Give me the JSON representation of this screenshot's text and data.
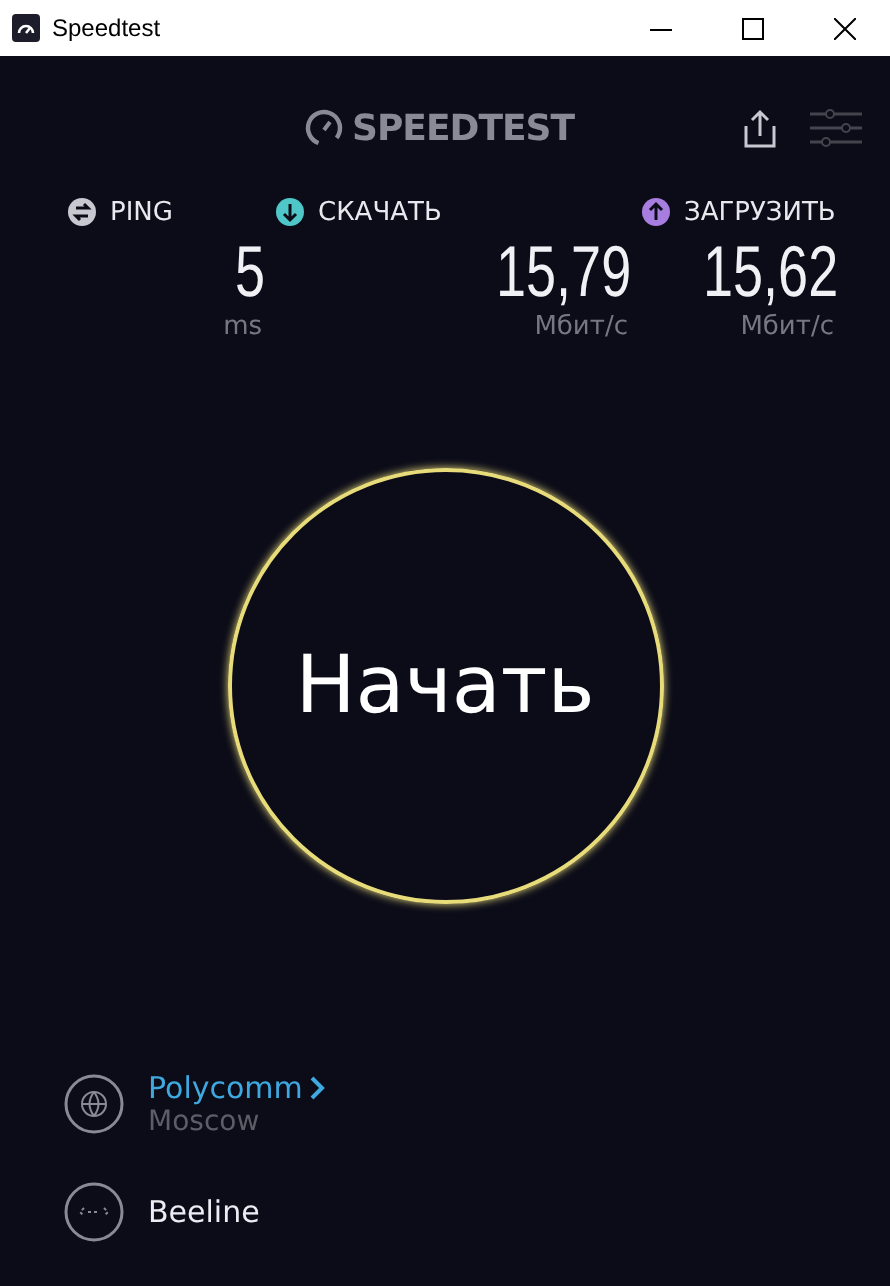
{
  "window": {
    "title": "Speedtest"
  },
  "logo": "SPEEDTEST",
  "metrics": [
    {
      "kind": "ping",
      "label": "PING",
      "value": "5",
      "unit": "ms",
      "color": "#c8c8d0"
    },
    {
      "kind": "download",
      "label": "СКАЧАТЬ",
      "value": "15,79",
      "unit": "Мбит/с",
      "color": "#4fc6c8"
    },
    {
      "kind": "upload",
      "label": "ЗАГРУЗИТЬ",
      "value": "15,62",
      "unit": "Мбит/с",
      "color": "#a77ee0"
    }
  ],
  "start_button": "Начать",
  "server": {
    "name": "Polycomm",
    "location": "Moscow"
  },
  "provider": {
    "name": "Beeline"
  }
}
